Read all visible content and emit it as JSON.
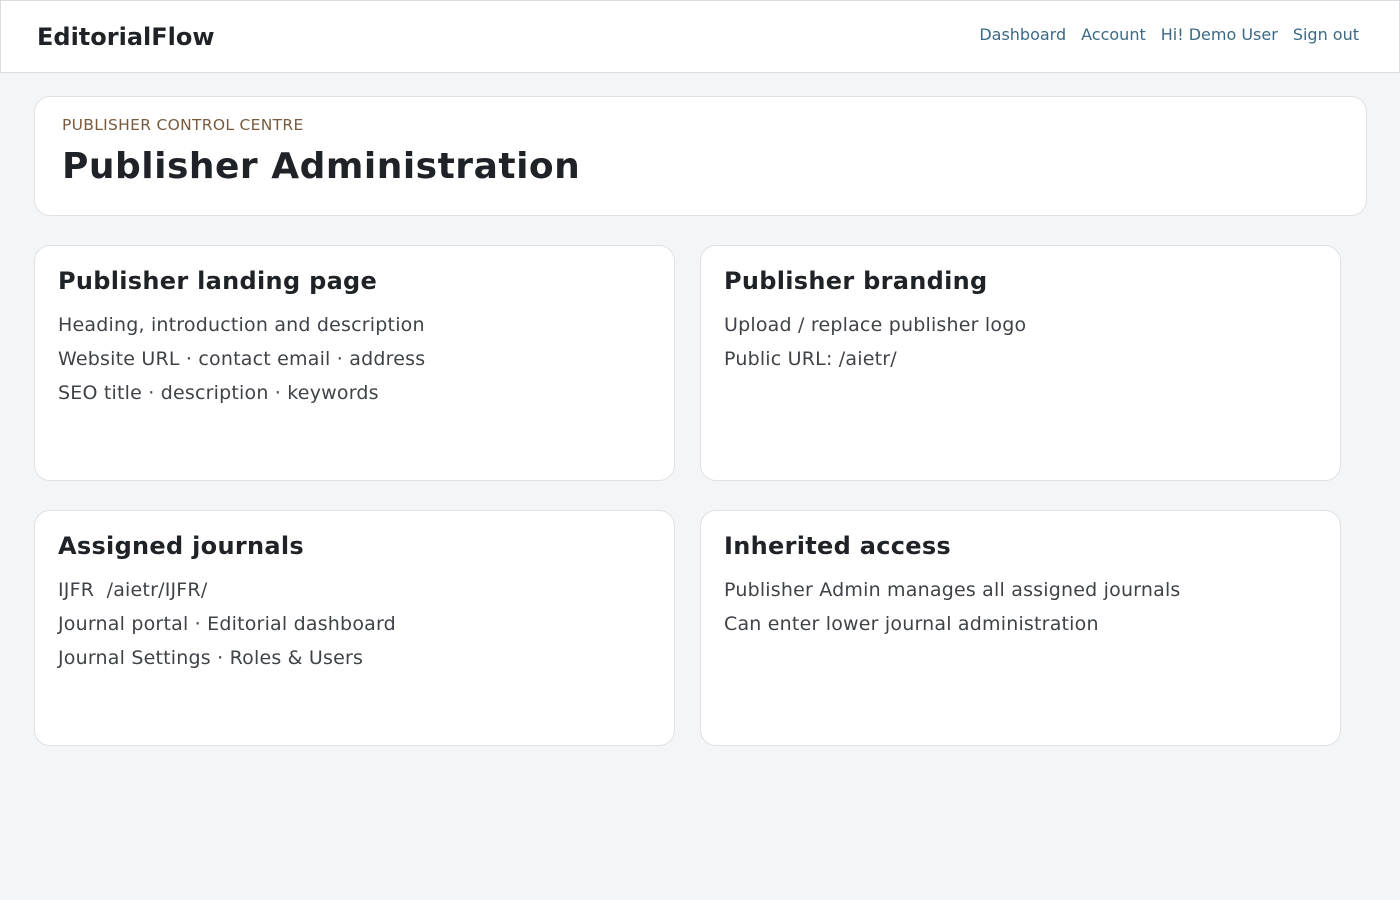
{
  "header": {
    "brand": "EditorialFlow",
    "nav": {
      "dashboard": "Dashboard",
      "account": "Account",
      "greeting": "Hi! Demo User",
      "sign_out": "Sign out"
    }
  },
  "hero": {
    "eyebrow": "PUBLISHER CONTROL CENTRE",
    "title": "Publisher Administration"
  },
  "cards": {
    "landing": {
      "title": "Publisher landing page",
      "lines": [
        "Heading, introduction and description",
        "Website URL · contact email · address",
        "SEO title · description · keywords"
      ]
    },
    "branding": {
      "title": "Publisher branding",
      "lines": [
        "Upload / replace publisher logo",
        "Public URL: /aietr/"
      ]
    },
    "journals": {
      "title": "Assigned journals",
      "lines": [
        "IJFR  /aietr/IJFR/",
        "Journal portal · Editorial dashboard",
        "Journal Settings · Roles & Users"
      ]
    },
    "access": {
      "title": "Inherited access",
      "lines": [
        "Publisher Admin manages all assigned journals",
        "Can enter lower journal administration"
      ]
    }
  },
  "colors": {
    "page_background": "#f4f5f7",
    "nav_link": "#3b6a86",
    "eyebrow": "#7a5a3c",
    "heading": "#1f2226",
    "body_text": "#3f4348"
  }
}
